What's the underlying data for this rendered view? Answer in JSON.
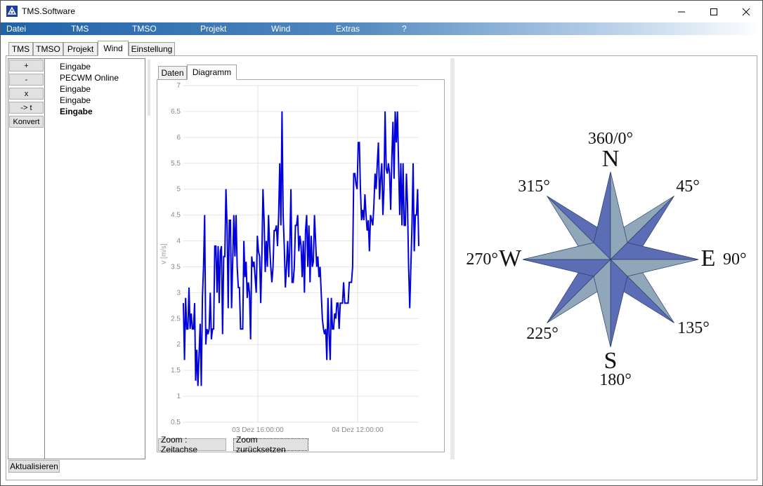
{
  "window": {
    "title": "TMS.Software"
  },
  "menu": [
    "Datei",
    "TMS",
    "TMSO",
    "Projekt",
    "Wind",
    "Extras",
    "?"
  ],
  "main_tabs": [
    {
      "label": "TMS",
      "active": false
    },
    {
      "label": "TMSO",
      "active": false
    },
    {
      "label": "Projekt",
      "active": false
    },
    {
      "label": "Wind",
      "active": true
    },
    {
      "label": "Einstellung",
      "active": false
    }
  ],
  "side_buttons": [
    "+",
    "-",
    "x",
    "-> t",
    "Konvert"
  ],
  "list_items": [
    {
      "label": "Eingabe",
      "bold": false
    },
    {
      "label": "PECWM Online",
      "bold": false
    },
    {
      "label": "Eingabe",
      "bold": false
    },
    {
      "label": "Eingabe",
      "bold": false
    },
    {
      "label": "Eingabe",
      "bold": true
    }
  ],
  "chart_tabs": [
    {
      "label": "Daten",
      "active": false
    },
    {
      "label": "Diagramm",
      "active": true
    }
  ],
  "chart_buttons": {
    "zoom_time": "Zoom :  Zeitachse",
    "zoom_reset": "Zoom zurücksetzen"
  },
  "refresh_label": "Aktualisieren",
  "compass": {
    "north": "N",
    "north_deg": "360/0°",
    "east": "E",
    "east_deg": "90°",
    "south": "S",
    "south_deg": "180°",
    "west": "W",
    "west_deg": "270°",
    "ne_deg": "45°",
    "se_deg": "135°",
    "sw_deg": "225°",
    "nw_deg": "315°",
    "colors": {
      "dark": "#5b6db5",
      "light": "#8fa7b8"
    }
  },
  "chart_data": {
    "type": "line",
    "ylabel": "v [m/s]",
    "xlabel": "",
    "ylim": [
      0.5,
      7
    ],
    "yticks": [
      "7",
      "6.5",
      "6",
      "5.5",
      "5",
      "4.5",
      "4",
      "3.5",
      "3",
      "2.5",
      "2",
      "1.5",
      "1",
      "0.5"
    ],
    "xticks": [
      "03 Dez 16:00:00",
      "04 Dez 12:00:00"
    ],
    "grid": true,
    "series": [
      {
        "color": "#0000dd",
        "values": [
          2.8,
          1.7,
          2.9,
          2.3,
          2.3,
          3.1,
          2.3,
          2.6,
          2.3,
          2.3,
          2.8,
          1.3,
          1.9,
          1.2,
          1.8,
          2.4,
          1.2,
          2.9,
          3.5,
          4.5,
          2.0,
          2.3,
          2.2,
          2.3,
          3.0,
          2.1,
          2.3,
          2.3,
          3.9,
          3.9,
          3.0,
          3.9,
          2.8,
          3.8,
          3.9,
          2.2,
          3.7,
          3.7,
          5.0,
          4.3,
          2.7,
          4.4,
          4.4,
          2.7,
          3.6,
          4.5,
          3.7,
          4.5,
          3.5,
          3.1,
          3.1,
          2.3,
          2.3,
          2.3,
          4.0,
          3.3,
          3.6,
          2.9,
          3.2,
          3.0,
          2.1,
          3.7,
          3.5,
          3.6,
          3.3,
          3.0,
          4.1,
          3.8,
          3.7,
          2.8,
          3.7,
          5.0,
          4.4,
          3.4,
          4.0,
          3.5,
          4.5,
          3.9,
          3.5,
          3.2,
          3.5,
          4.2,
          4.2,
          4.3,
          3.9,
          4.5,
          5.5,
          4.3,
          6.5,
          4.5,
          3.9,
          3.1,
          3.5,
          4.0,
          3.3,
          3.9,
          5.0,
          3.2,
          3.2,
          3.5,
          4.3,
          4.3,
          4.5,
          3.8,
          4.1,
          3.9,
          3.3,
          4.0,
          3.0,
          4.2,
          4.5,
          3.5,
          4.3,
          3.2,
          4.1,
          3.5,
          3.6,
          4.5,
          4.0,
          3.5,
          3.7,
          3.3,
          3.5,
          3.0,
          2.5,
          2.3,
          2.2,
          2.3,
          1.7,
          2.9,
          2.2,
          1.7,
          2.9,
          2.3,
          2.3,
          2.6,
          2.5,
          2.8,
          2.8,
          2.3,
          2.8,
          2.8,
          2.8,
          3.2,
          2.8,
          2.8,
          2.8,
          2.8,
          3.2,
          3.2,
          3.2,
          3.5,
          5.3,
          5.3,
          5.1,
          5.0,
          5.9,
          5.9,
          5.0,
          4.4,
          4.6,
          4.4,
          4.9,
          4.5,
          4.2,
          4.4,
          3.8,
          4.5,
          4.4,
          4.3,
          4.7,
          5.3,
          5.0,
          5.5,
          5.9,
          4.8,
          5.2,
          5.5,
          4.5,
          5.0,
          6.5,
          5.4,
          5.3,
          5.5,
          5.3,
          4.6,
          5.6,
          6.3,
          5.2,
          6.5,
          5.9,
          6.5,
          5.5,
          4.5,
          5.5,
          4.3,
          5.5,
          4.3,
          4.3,
          5.3,
          4.7,
          3.5,
          2.7,
          3.5,
          4.3,
          5.5,
          3.8,
          4.5,
          4.5,
          5.0,
          3.9
        ]
      }
    ]
  }
}
